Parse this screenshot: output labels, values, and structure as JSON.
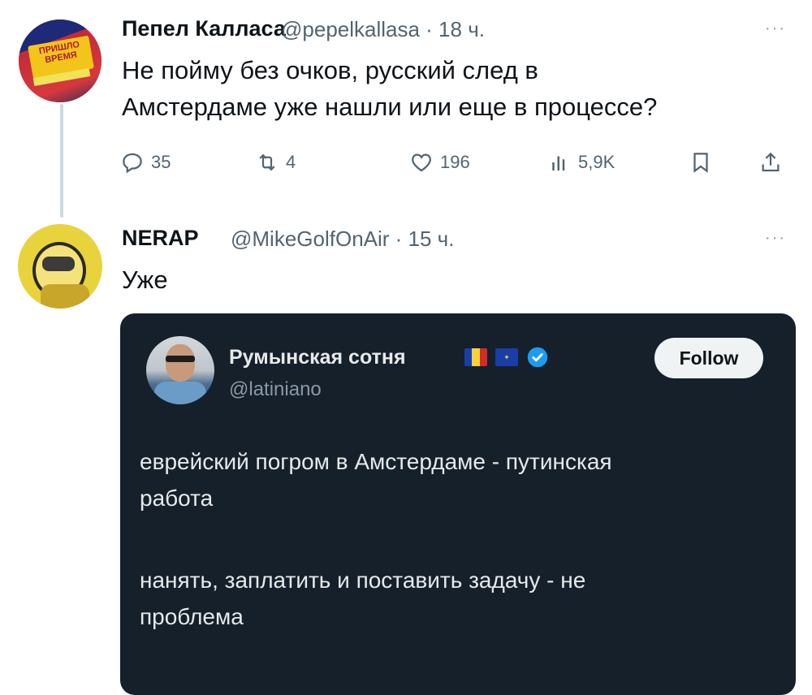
{
  "colors": {
    "text": "#0f1419",
    "muted": "#536471",
    "card_bg": "#15202b",
    "card_text": "#e7e9ea",
    "verified": "#1d9bf0"
  },
  "tweet1": {
    "name": "Пепел Калласа",
    "meta": "@pepelkallasa · 18 ч.",
    "more": "···",
    "lines": [
      "Не пойму без очков, русский след в",
      "Амстердаме уже нашли или еще в процессе?"
    ],
    "avatar_text": [
      "ПРИШЛО",
      "ВРЕМЯ"
    ],
    "actions": {
      "reply": {
        "icon": "reply-icon",
        "count": "35"
      },
      "retweet": {
        "icon": "retweet-icon",
        "count": "4"
      },
      "like": {
        "icon": "heart-icon",
        "count": "196"
      },
      "views": {
        "icon": "views-icon",
        "count": "5,9K"
      },
      "bookmark": {
        "icon": "bookmark-icon"
      },
      "share": {
        "icon": "share-icon"
      }
    }
  },
  "tweet2": {
    "name": "NERAP",
    "meta": "@MikeGolfOnAir · 15 ч.",
    "more": "···",
    "text": "Уже"
  },
  "quoted": {
    "name": "Румынская сотня",
    "handle": "@latiniano",
    "follow_label": "Follow",
    "paragraph1": [
      "еврейский погром в Амстердаме - путинская",
      "работа"
    ],
    "paragraph2": [
      "нанять, заплатить и поставить задачу - не",
      "проблема"
    ]
  }
}
